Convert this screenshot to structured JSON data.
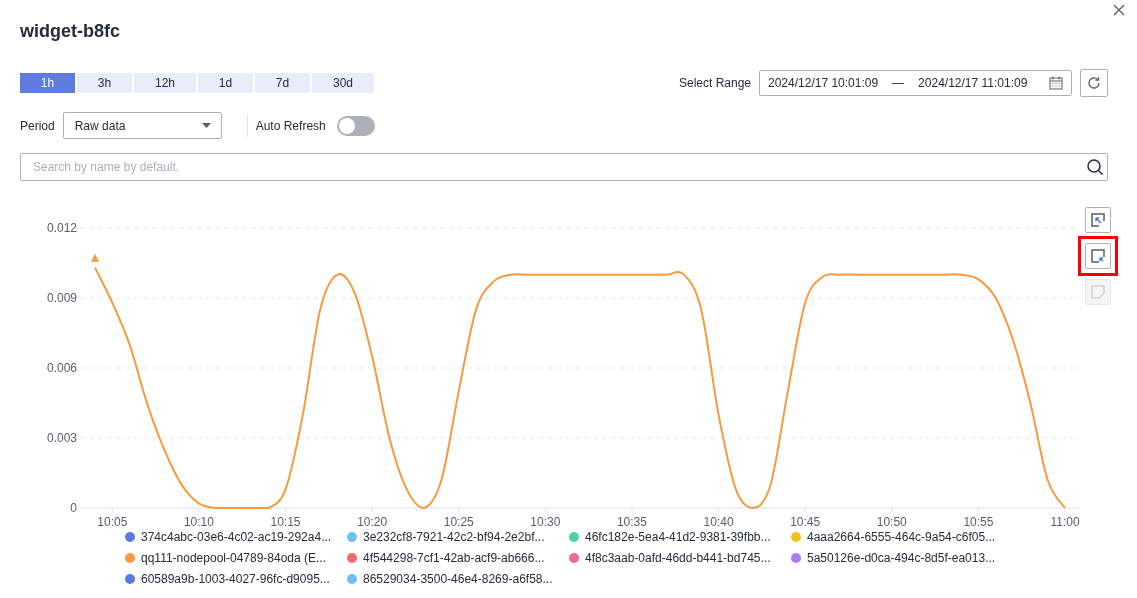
{
  "dialog": {
    "title": "widget-b8fc"
  },
  "ranges": [
    {
      "label": "1h",
      "selected": true
    },
    {
      "label": "3h",
      "selected": false
    },
    {
      "label": "12h",
      "selected": false
    },
    {
      "label": "1d",
      "selected": false
    },
    {
      "label": "7d",
      "selected": false
    },
    {
      "label": "30d",
      "selected": false
    }
  ],
  "select_range": {
    "label": "Select Range",
    "start": "2024/12/17 10:01:09",
    "separator": "—",
    "end": "2024/12/17 11:01:09"
  },
  "period": {
    "label": "Period",
    "value": "Raw data"
  },
  "auto_refresh": {
    "label": "Auto Refresh",
    "on": false
  },
  "search": {
    "placeholder": "Search by name by default."
  },
  "chart_tools": [
    {
      "kind": "zoom-in",
      "disabled": false,
      "highlighted": false
    },
    {
      "kind": "zoom-out",
      "disabled": false,
      "highlighted": true
    },
    {
      "kind": "reset",
      "disabled": true,
      "highlighted": false
    }
  ],
  "chart_data": {
    "type": "line",
    "categories": [
      null,
      "10:05",
      null,
      null,
      null,
      null,
      "10:10",
      null,
      null,
      null,
      null,
      "10:15",
      null,
      null,
      null,
      null,
      "10:20",
      null,
      null,
      null,
      null,
      "10:25",
      null,
      null,
      null,
      null,
      "10:30",
      null,
      null,
      null,
      null,
      "10:35",
      null,
      null,
      null,
      null,
      "10:40",
      null,
      null,
      null,
      null,
      "10:45",
      null,
      null,
      null,
      null,
      "10:50",
      null,
      null,
      null,
      null,
      "10:55",
      null,
      null,
      null,
      null,
      "11:00"
    ],
    "grid": true,
    "series": [
      {
        "color": "#f79a3e",
        "values": [
          0.0103,
          0.0088,
          0.007,
          0.0045,
          0.0025,
          0.001,
          0.0002,
          0,
          0,
          0,
          0,
          0.0008,
          0.004,
          0.0085,
          0.01,
          0.0092,
          0.0065,
          0.003,
          0.0008,
          0,
          0.0012,
          0.005,
          0.0085,
          0.0097,
          0.01,
          0.01,
          0.01,
          0.01,
          0.01,
          0.01,
          0.01,
          0.01,
          0.01,
          0.01,
          0.01,
          0.0085,
          0.004,
          0.0008,
          0,
          0.001,
          0.005,
          0.0088,
          0.0099,
          0.01,
          0.01,
          0.01,
          0.01,
          0.01,
          0.01,
          0.01,
          0.01,
          0.0098,
          0.009,
          0.0072,
          0.0045,
          0.0012,
          0
        ]
      }
    ],
    "ylim": [
      0,
      0.012
    ],
    "yticks": [
      {
        "value": 0,
        "label": "0"
      },
      {
        "value": 0.003,
        "label": "0.003"
      },
      {
        "value": 0.006,
        "label": "0.006"
      },
      {
        "value": 0.009,
        "label": "0.009"
      },
      {
        "value": 0.012,
        "label": "0.012"
      }
    ]
  },
  "legend": [
    {
      "name": "374c4abc-03e6-4c02-ac19-292a4...",
      "color": "#5b7be0"
    },
    {
      "name": "3e232cf8-7921-42c2-bf94-2e2bf...",
      "color": "#6cc0f8"
    },
    {
      "name": "46fc182e-5ea4-41d2-9381-39fbb...",
      "color": "#4fd1a5"
    },
    {
      "name": "4aaa2664-6555-464c-9a54-c6f05...",
      "color": "#f5c01a"
    },
    {
      "name": "qq111-nodepool-04789-84oda (E...",
      "color": "#f79a3e"
    },
    {
      "name": "4f544298-7cf1-42ab-acf9-ab666...",
      "color": "#f06c6c"
    },
    {
      "name": "4f8c3aab-0afd-46dd-b441-bd745...",
      "color": "#f0689a"
    },
    {
      "name": "5a50126e-d0ca-494c-8d5f-ea013...",
      "color": "#a67ef0"
    },
    {
      "name": "60589a9b-1003-4027-96fc-d9095...",
      "color": "#5b7be0"
    },
    {
      "name": "86529034-3500-46e4-8269-a6f58...",
      "color": "#6cc0f8"
    }
  ]
}
